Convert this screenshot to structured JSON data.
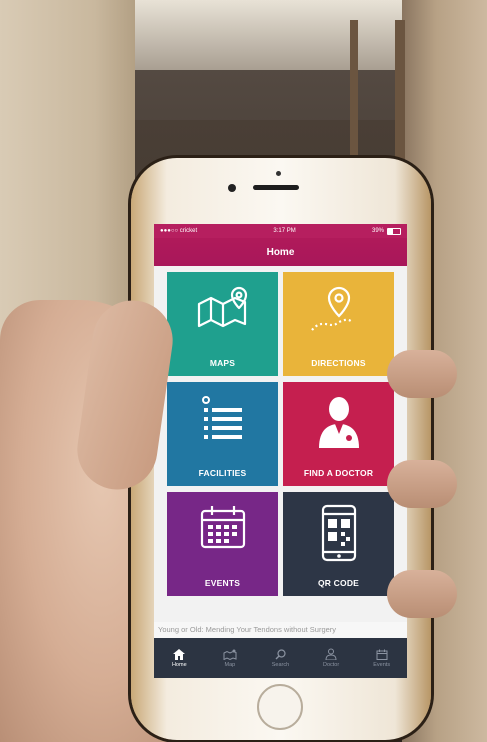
{
  "status_bar": {
    "carrier": "●●●○○ cricket",
    "time": "3:17 PM",
    "battery_text": "39%",
    "battery_level": 0.39
  },
  "nav": {
    "title": "Home"
  },
  "tiles": [
    {
      "label": "MAPS",
      "color": "#1fa08e",
      "icon": "folded-map-pin-icon"
    },
    {
      "label": "DIRECTIONS",
      "color": "#e9b43a",
      "icon": "route-pin-icon"
    },
    {
      "label": "FACILITIES",
      "color": "#2177a2",
      "icon": "list-icon"
    },
    {
      "label": "FIND A DOCTOR",
      "color": "#c51f4f",
      "icon": "doctor-icon"
    },
    {
      "label": "EVENTS",
      "color": "#772787",
      "icon": "calendar-icon"
    },
    {
      "label": "QR CODE",
      "color": "#2d3646",
      "icon": "qr-phone-icon"
    }
  ],
  "ticker": {
    "text": "Young or Old: Mending Your Tendons without Surgery"
  },
  "tabs": [
    {
      "label": "Home",
      "icon": "home-icon",
      "active": true
    },
    {
      "label": "Map",
      "icon": "map-icon",
      "active": false
    },
    {
      "label": "Search",
      "icon": "search-icon",
      "active": false
    },
    {
      "label": "Doctor",
      "icon": "doctor-tab-icon",
      "active": false
    },
    {
      "label": "Events",
      "icon": "calendar-tab-icon",
      "active": false
    }
  ],
  "colors": {
    "brand": "#b61f5f",
    "tab_bar": "#2c3442"
  }
}
